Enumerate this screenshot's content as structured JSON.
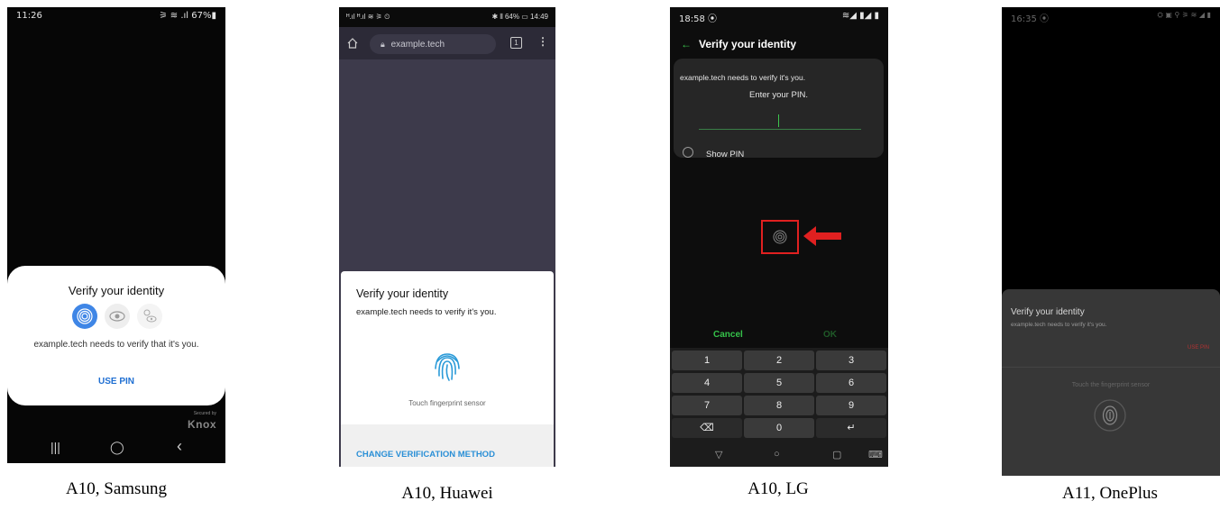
{
  "samsung": {
    "time": "11:26",
    "status_right": "⚞ ≋ .ıl 67%▮",
    "dialog_title": "Verify your identity",
    "dialog_message": "example.tech needs to verify that it's you.",
    "use_pin": "USE PIN",
    "knox_small": "Secured by",
    "knox": "Knox",
    "nav_recent": "|||",
    "nav_home": "◯",
    "nav_back": "‹",
    "caption": "A10, Samsung"
  },
  "huawei": {
    "status_left": "ᴴ.ıl ᴴ.ıl ≋ ⚞ ⏲",
    "status_right": "✱ ⫴ 64% ▭ 14:49",
    "url": "example.tech",
    "tab_count": "1",
    "dialog_title": "Verify your identity",
    "dialog_message": "example.tech needs to verify it's you.",
    "touch_sensor": "Touch fingerprint sensor",
    "change_method": "CHANGE VERIFICATION METHOD",
    "caption": "A10, Huawei"
  },
  "lg": {
    "time": "18:58 ⦿",
    "status_right": "≋◢ ▮◢ ▮",
    "header": "Verify your identity",
    "message": "example.tech needs to verify it's you.",
    "enter_pin": "Enter your PIN.",
    "show_pin": "Show PIN",
    "cancel": "Cancel",
    "ok": "OK",
    "keys": [
      "1",
      "2",
      "3",
      "4",
      "5",
      "6",
      "7",
      "8",
      "9",
      "⌫",
      "0",
      "↵"
    ],
    "caption": "A10, LG"
  },
  "oneplus": {
    "time": "16:35 ⦿",
    "status_right": "⛭ ▣ ⚲ ⚞ ≋ ◢ ▮",
    "title": "Verify your identity",
    "message": "example.tech needs to verify it's you.",
    "use_pin": "USE PIN",
    "touch_sensor": "Touch the fingerprint sensor",
    "caption": "A11, OnePlus"
  }
}
